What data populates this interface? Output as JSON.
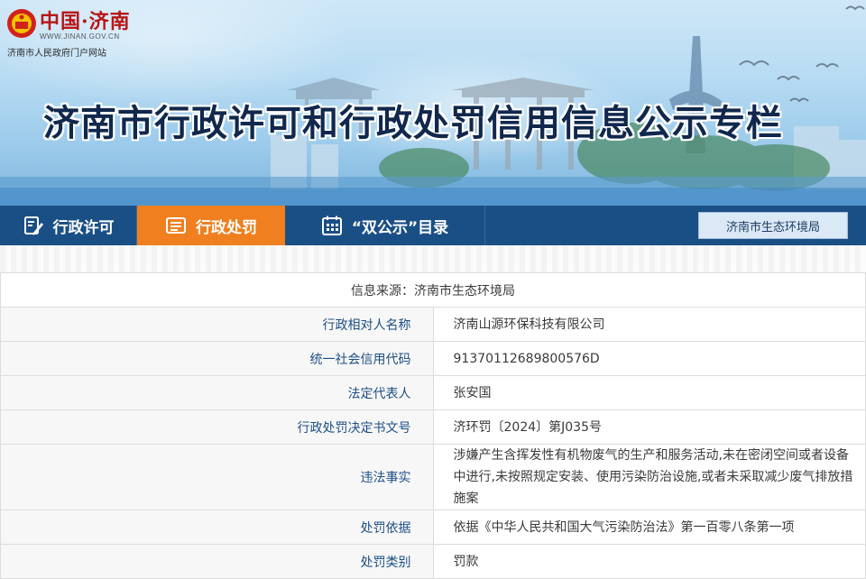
{
  "logo": {
    "brand": "中国·济南",
    "url": "WWW.JINAN.GOV.CN",
    "subtitle": "济南市人民政府门户网站",
    "emblem_icon": "national-emblem-icon"
  },
  "banner": {
    "title": "济南市行政许可和行政处罚信用信息公示专栏"
  },
  "nav": {
    "items": [
      {
        "label": "行政许可",
        "icon": "edit-document-icon",
        "active": false
      },
      {
        "label": "行政处罚",
        "icon": "list-document-icon",
        "active": true
      },
      {
        "label": "“双公示”目录",
        "icon": "calendar-grid-icon",
        "active": false
      }
    ],
    "agency_button": "济南市生态环境局"
  },
  "record": {
    "source": "信息来源：济南市生态环境局",
    "rows": [
      {
        "label": "行政相对人名称",
        "value": "济南山源环保科技有限公司"
      },
      {
        "label": "统一社会信用代码",
        "value": "91370112689800576D"
      },
      {
        "label": "法定代表人",
        "value": "张安国"
      },
      {
        "label": "行政处罚决定书文号",
        "value": "济环罚〔2024〕第J035号"
      },
      {
        "label": "违法事实",
        "value": "涉嫌产生含挥发性有机物废气的生产和服务活动,未在密闭空间或者设备中进行,未按照规定安装、使用污染防治设施,或者未采取减少废气排放措施案"
      },
      {
        "label": "处罚依据",
        "value": "依据《中华人民共和国大气污染防治法》第一百零八条第一项"
      },
      {
        "label": "处罚类别",
        "value": "罚款"
      }
    ]
  },
  "colors": {
    "nav_bg": "#1a4f86",
    "nav_active": "#ef7f1f",
    "label_text": "#1c4f87",
    "title_text": "#11284d",
    "brand_red": "#b81515"
  }
}
